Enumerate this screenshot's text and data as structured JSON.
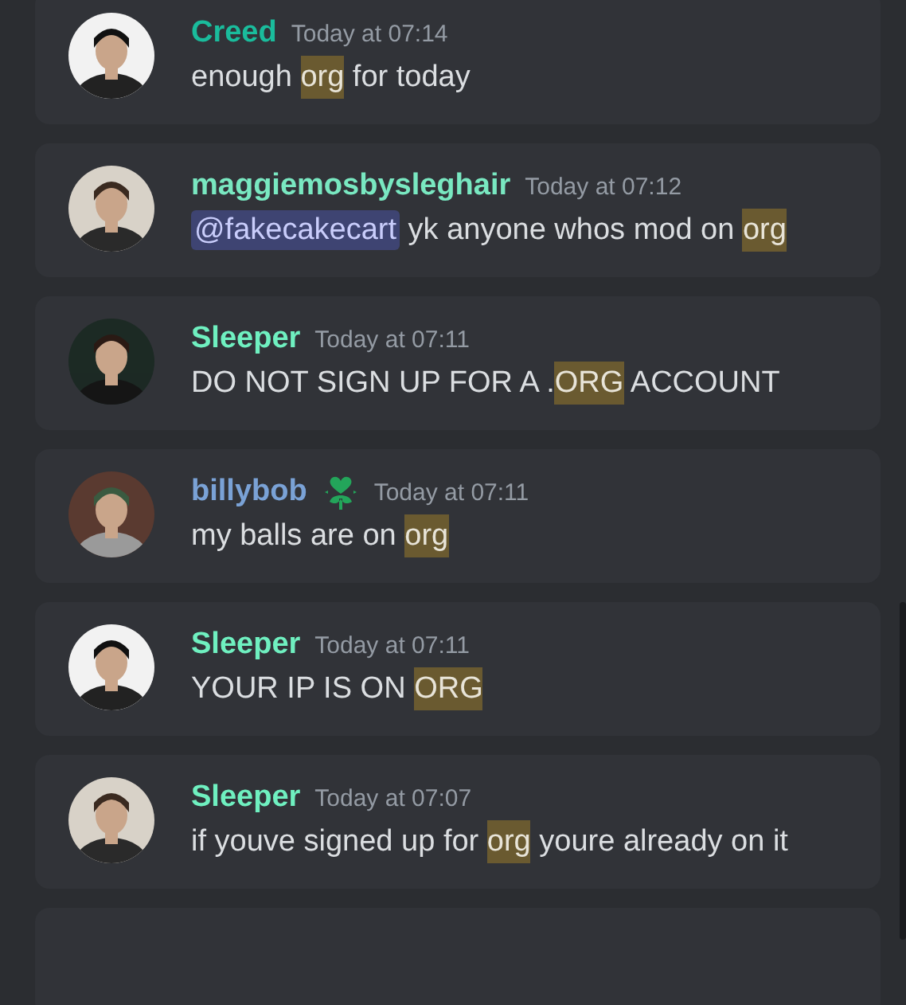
{
  "messages": [
    {
      "author": "Creed",
      "color": "#1abc9c",
      "role_icon": false,
      "time": "Today at 07:14",
      "content": [
        {
          "kind": "text",
          "text": "enough "
        },
        {
          "kind": "highlight",
          "text": "org"
        },
        {
          "kind": "text",
          "text": " for today"
        }
      ]
    },
    {
      "author": "maggiemosbysleghair",
      "color": "#79e8c1",
      "role_icon": false,
      "time": "Today at 07:12",
      "content": [
        {
          "kind": "mention",
          "text": "@fakecakecart"
        },
        {
          "kind": "text",
          "text": " yk anyone whos mod on "
        },
        {
          "kind": "highlight",
          "text": "org"
        }
      ]
    },
    {
      "author": "Sleeper",
      "color": "#6ff0c0",
      "role_icon": false,
      "time": "Today at 07:11",
      "content": [
        {
          "kind": "text",
          "text": "DO NOT SIGN UP FOR A ."
        },
        {
          "kind": "highlight",
          "text": "ORG"
        },
        {
          "kind": "text",
          "text": " ACCOUNT"
        }
      ]
    },
    {
      "author": "billybob",
      "color": "#7aa2d6",
      "role_icon": true,
      "time": "Today at 07:11",
      "content": [
        {
          "kind": "text",
          "text": "my balls are on "
        },
        {
          "kind": "highlight",
          "text": "org"
        }
      ]
    },
    {
      "author": "Sleeper",
      "color": "#6ff0c0",
      "role_icon": false,
      "time": "Today at 07:11",
      "content": [
        {
          "kind": "text",
          "text": "YOUR IP IS ON "
        },
        {
          "kind": "highlight",
          "text": "ORG"
        }
      ]
    },
    {
      "author": "Sleeper",
      "color": "#6ff0c0",
      "role_icon": false,
      "time": "Today at 07:07",
      "content": [
        {
          "kind": "text",
          "text": "if youve signed up for "
        },
        {
          "kind": "highlight",
          "text": "org"
        },
        {
          "kind": "text",
          "text": " youre already on it"
        }
      ]
    }
  ]
}
